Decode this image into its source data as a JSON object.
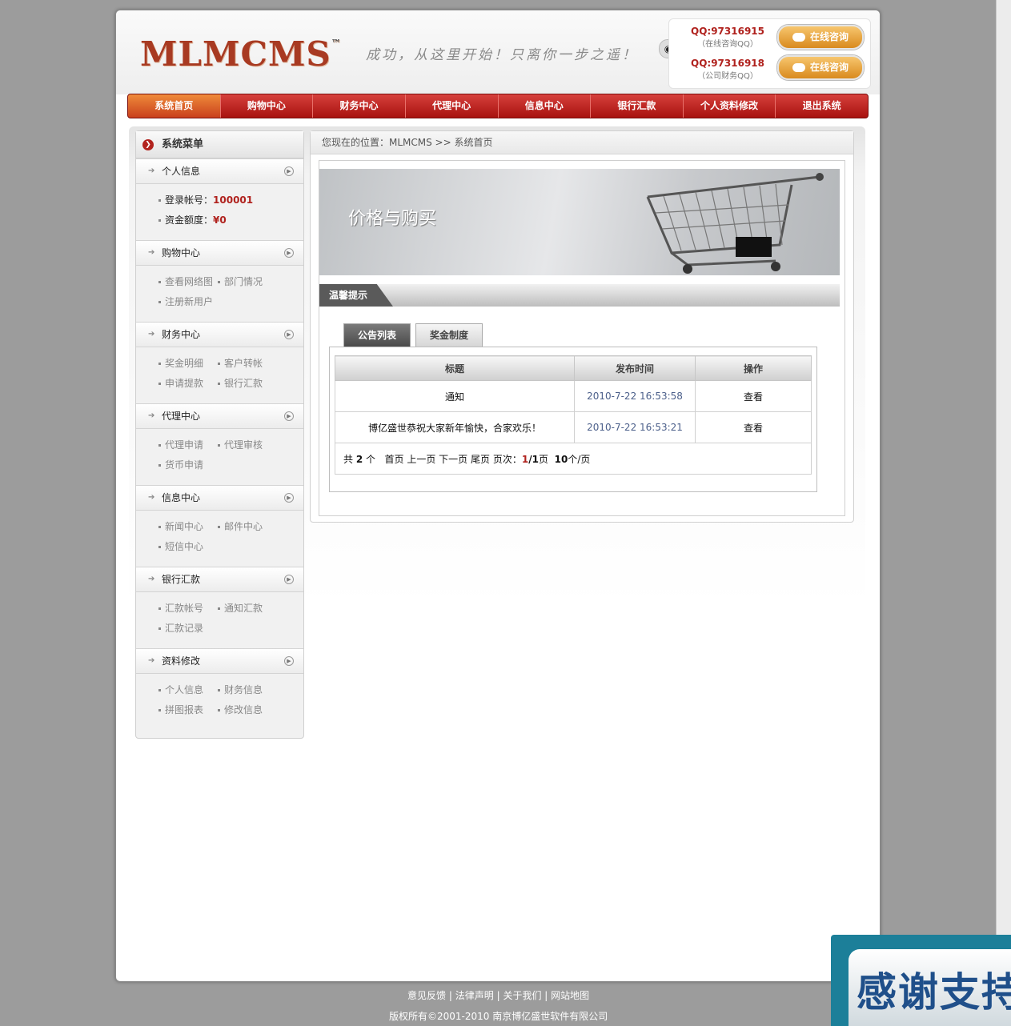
{
  "header": {
    "logo": "MLMCMS",
    "logo_tm": "™",
    "slogan": "成功，从这里开始！只离你一步之遥！",
    "qq": [
      {
        "number": "QQ:97316915",
        "note": "（在线咨询QQ）",
        "button": "在线咨询"
      },
      {
        "number": "QQ:97316918",
        "note": "（公司财务QQ）",
        "button": "在线咨询"
      }
    ]
  },
  "nav": [
    "系统首页",
    "购物中心",
    "财务中心",
    "代理中心",
    "信息中心",
    "银行汇款",
    "个人资料修改",
    "退出系统"
  ],
  "sidebar": {
    "title": "系统菜单",
    "personal": {
      "title": "个人信息",
      "login_label": "登录帐号：",
      "login_value": "100001",
      "fund_label": "资金额度：",
      "fund_value": "¥0"
    },
    "sections": [
      {
        "title": "购物中心",
        "rows": [
          [
            "查看网络图",
            "部门情况"
          ],
          [
            "注册新用户"
          ]
        ]
      },
      {
        "title": "财务中心",
        "rows": [
          [
            "奖金明细",
            "客户转帐"
          ],
          [
            "申请提款",
            "银行汇款"
          ]
        ]
      },
      {
        "title": "代理中心",
        "rows": [
          [
            "代理申请",
            "代理审核"
          ],
          [
            "货币申请"
          ]
        ]
      },
      {
        "title": "信息中心",
        "rows": [
          [
            "新闻中心",
            "邮件中心"
          ],
          [
            "短信中心"
          ]
        ]
      },
      {
        "title": "银行汇款",
        "rows": [
          [
            "汇款帐号",
            "通知汇款"
          ],
          [
            "汇款记录"
          ]
        ]
      },
      {
        "title": "资料修改",
        "rows": [
          [
            "个人信息",
            "财务信息"
          ],
          [
            "拼图报表",
            "修改信息"
          ]
        ]
      }
    ]
  },
  "main": {
    "breadcrumb": "您现在的位置：MLMCMS >> 系统首页",
    "banner_text": "价格与购买",
    "tip_title": "温馨提示",
    "tabs": [
      "公告列表",
      "奖金制度"
    ],
    "table": {
      "headers": [
        "标题",
        "发布时间",
        "操作"
      ],
      "rows": [
        {
          "title": "通知",
          "time": "2010-7-22 16:53:58",
          "action": "查看"
        },
        {
          "title": "博亿盛世恭祝大家新年愉快，合家欢乐！",
          "time": "2010-7-22 16:53:21",
          "action": "查看"
        }
      ],
      "pager": {
        "total_prefix": "共 ",
        "total": "2",
        "total_suffix": " 个",
        "first": "首页",
        "prev": "上一页",
        "next": "下一页",
        "last": "尾页",
        "page_label": "页次：",
        "current": "1",
        "slash": "/",
        "pages": "1",
        "page_suffix": "页",
        "per_page": "10",
        "per_page_suffix": "个/页"
      }
    }
  },
  "footer": {
    "links": [
      "意见反馈",
      "法律声明",
      "关于我们",
      "网站地图"
    ],
    "separator": "|",
    "copyright": "版权所有©2001-2010 南京博亿盛世软件有限公司"
  },
  "overlay": {
    "text": "感谢支持"
  },
  "colors": {
    "brand_red": "#b0221e",
    "nav_red": "#c0201c",
    "accent_orange": "#e4a43c"
  }
}
